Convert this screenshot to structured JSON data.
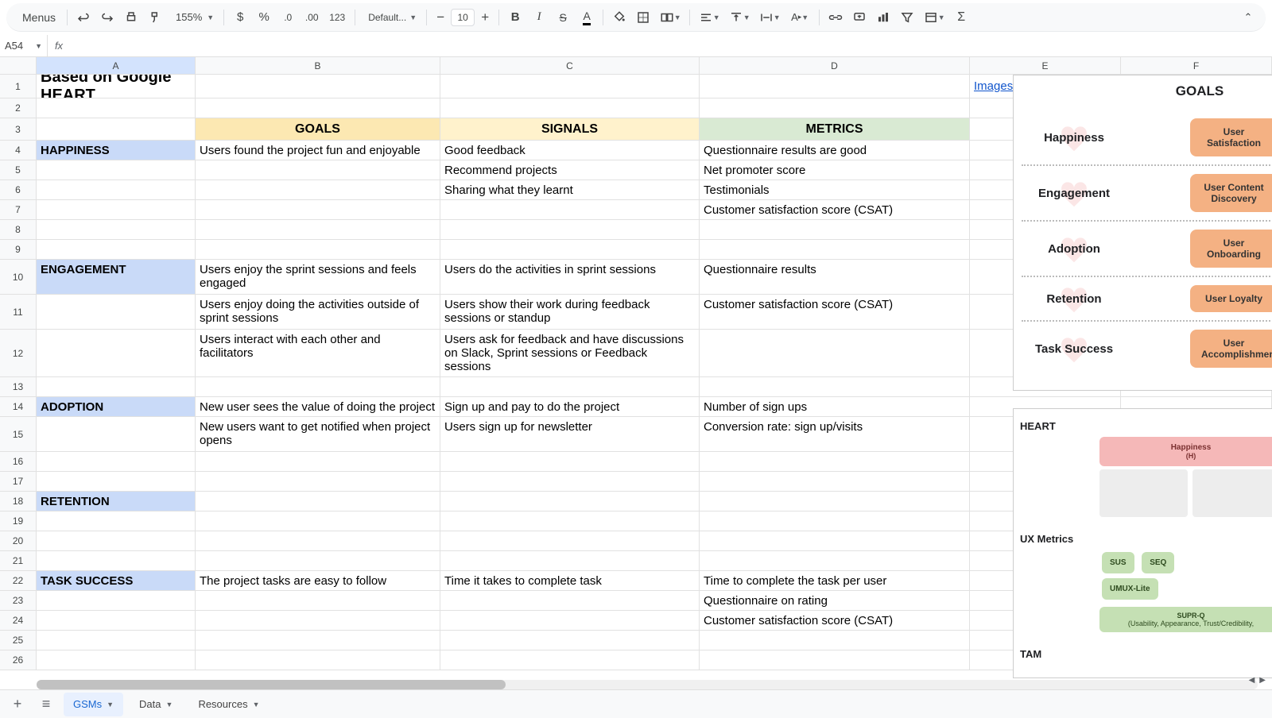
{
  "toolbar": {
    "menus_label": "Menus",
    "zoom": "155%",
    "font": "Default...",
    "font_size": "10",
    "fmt_123": "123"
  },
  "name_box": "A54",
  "formula": "",
  "columns": [
    "A",
    "B",
    "C",
    "D",
    "E",
    "F"
  ],
  "rows_header": [
    "1",
    "2",
    "3",
    "4",
    "5",
    "6",
    "7",
    "8",
    "9",
    "10",
    "11",
    "12",
    "13",
    "14",
    "15",
    "16",
    "17",
    "18",
    "19",
    "20",
    "21",
    "22",
    "23",
    "24",
    "25",
    "26"
  ],
  "cells": {
    "A1": "Based on Google HEART",
    "E1": "Images from MeasuringU",
    "B3": "GOALS",
    "C3": "SIGNALS",
    "D3": "METRICS",
    "A4": "HAPPINESS",
    "B4": "Users found the project fun and enjoyable",
    "C4": "Good feedback",
    "D4": "Questionnaire results are good",
    "C5": "Recommend projects",
    "D5": "Net promoter score",
    "C6": "Sharing what they learnt",
    "D6": "Testimonials",
    "D7": "Customer satisfaction score (CSAT)",
    "A10": "ENGAGEMENT",
    "B10": "Users enjoy the sprint sessions and feels engaged",
    "C10": "Users do the activities in sprint sessions",
    "D10": "Questionnaire results",
    "B11": "Users enjoy doing the activities outside of sprint sessions",
    "C11": "Users show their work during feedback sessions or standup",
    "D11": "Customer satisfaction score (CSAT)",
    "B12": "Users interact with each other and facilitators",
    "C12": "Users ask for feedback and have discussions on Slack, Sprint sessions or Feedback sessions",
    "A14": "ADOPTION",
    "B14": "New user sees the value of doing the project",
    "C14": "Sign up and pay to do the project",
    "D14": "Number of sign ups",
    "B15": "New users want to get notified when project opens",
    "C15": "Users sign up for newsletter",
    "D15": "Conversion rate: sign up/visits",
    "A18": "RETENTION",
    "A22": "TASK SUCCESS",
    "B22": "The project tasks are easy to follow",
    "C22": "Time it takes to complete task",
    "D22": "Time to complete the task per user",
    "D23": "Questionnaire on rating",
    "D24": "Customer satisfaction score (CSAT)"
  },
  "img1": {
    "title": "GOALS",
    "rows": [
      {
        "label": "Happiness",
        "goal": "User Satisfaction"
      },
      {
        "label": "Engagement",
        "goal": "User Content Discovery"
      },
      {
        "label": "Adoption",
        "goal": "User Onboarding"
      },
      {
        "label": "Retention",
        "goal": "User Loyalty"
      },
      {
        "label": "Task Success",
        "goal": "User Accomplishment"
      }
    ]
  },
  "img2": {
    "heart_label": "HEART",
    "pink_title": "Happiness",
    "pink_sub": "(H)",
    "ux_label": "UX Metrics",
    "pills": [
      "SUS",
      "SEQ",
      "UMUX-Lite"
    ],
    "supr_title": "SUPR-Q",
    "supr_sub": "(Usability, Appearance, Trust/Credibility,",
    "tam_label": "TAM"
  },
  "tabs": {
    "t1": "GSMs",
    "t2": "Data",
    "t3": "Resources"
  }
}
